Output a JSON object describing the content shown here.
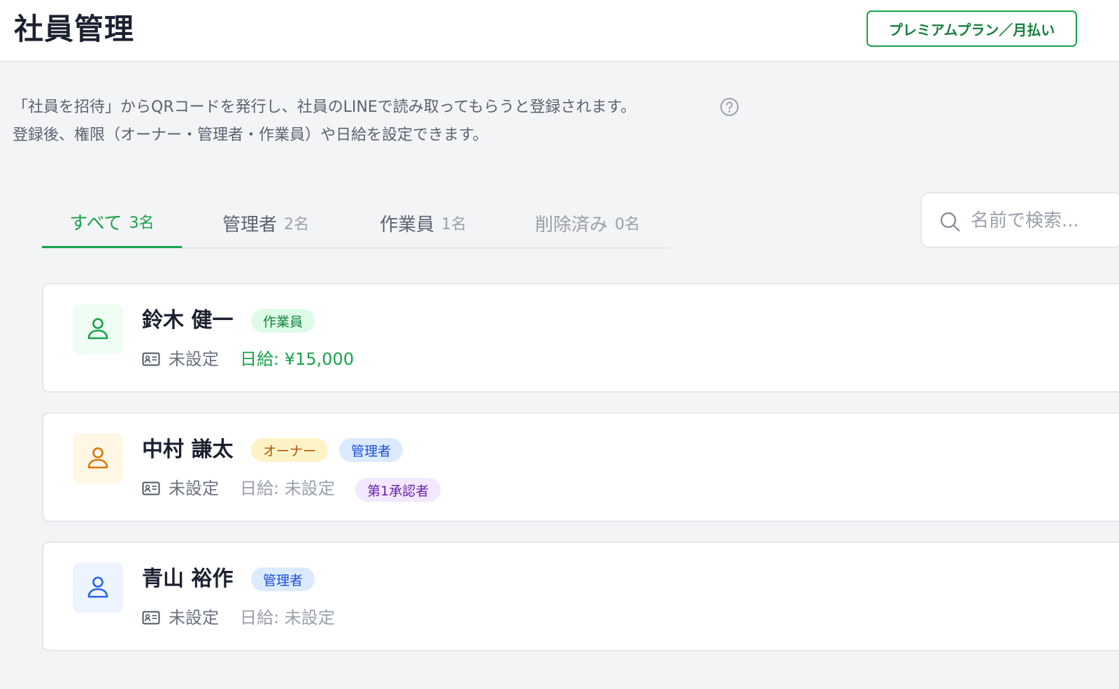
{
  "header": {
    "title": "社員管理",
    "plan_label": "プレミアムプラン／月払い"
  },
  "description": {
    "line1": "「社員を招待」からQRコードを発行し、社員のLINEで読み取ってもらうと登録されます。",
    "line2": "登録後、権限（オーナー・管理者・作業員）や日給を設定できます。"
  },
  "tabs": [
    {
      "label": "すべて",
      "count": "3名",
      "active": true
    },
    {
      "label": "管理者",
      "count": "2名",
      "active": false
    },
    {
      "label": "作業員",
      "count": "1名",
      "active": false
    },
    {
      "label": "削除済み",
      "count": "0名",
      "active": false
    }
  ],
  "search": {
    "placeholder": "名前で検索...",
    "value": ""
  },
  "employees": [
    {
      "name": "鈴木 健一",
      "avatar_color": "#16a34a",
      "tags": [
        "作業員"
      ],
      "employee_id": "未設定",
      "wage": "日給: ¥15,000",
      "extra_tag": ""
    },
    {
      "name": "中村 謙太",
      "avatar_color": "#d97706",
      "tags": [
        "オーナー",
        "管理者"
      ],
      "employee_id": "未設定",
      "wage": "日給: 未設定",
      "extra_tag": "第1承認者"
    },
    {
      "name": "青山 裕作",
      "avatar_color": "#2563eb",
      "tags": [
        "管理者"
      ],
      "employee_id": "未設定",
      "wage": "日給: 未設定",
      "extra_tag": ""
    }
  ],
  "icons": {
    "avatar": "person-icon",
    "id_card": "id-card-icon",
    "help": "help-circle-icon",
    "search": "search-icon"
  },
  "colors": {
    "accent": "#16a34a",
    "owner": "#b45309",
    "admin": "#1d4ed8",
    "approver": "#6b21a8"
  }
}
